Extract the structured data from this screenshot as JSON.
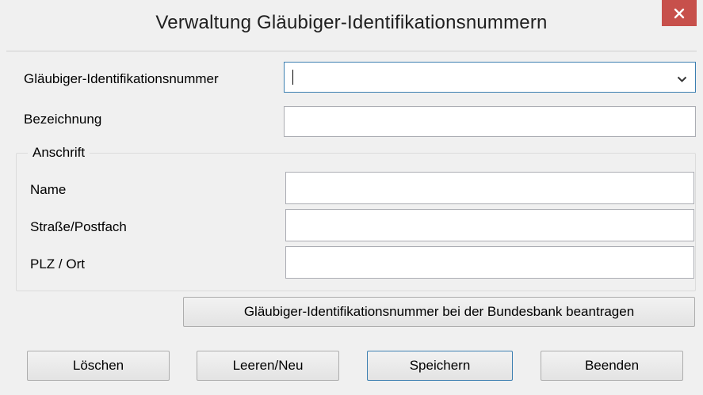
{
  "window": {
    "title": "Verwaltung Gläubiger-Identifikationsnummern",
    "close_label": "✕"
  },
  "form": {
    "glaeubiger_id": {
      "label": "Gläubiger-Identifikationsnummer",
      "value": ""
    },
    "bezeichnung": {
      "label": "Bezeichnung",
      "value": ""
    }
  },
  "anschrift": {
    "legend": "Anschrift",
    "name": {
      "label": "Name",
      "value": ""
    },
    "strasse": {
      "label": "Straße/Postfach",
      "value": ""
    },
    "plz_ort": {
      "label": "PLZ / Ort",
      "value": ""
    }
  },
  "buttons": {
    "beantragen": "Gläubiger-Identifikationsnummer bei der Bundesbank beantragen",
    "loeschen": "Löschen",
    "leeren_neu": "Leeren/Neu",
    "speichern": "Speichern",
    "beenden": "Beenden"
  },
  "colors": {
    "close_button": "#c7504b",
    "focus_border": "#3c7fb1"
  }
}
